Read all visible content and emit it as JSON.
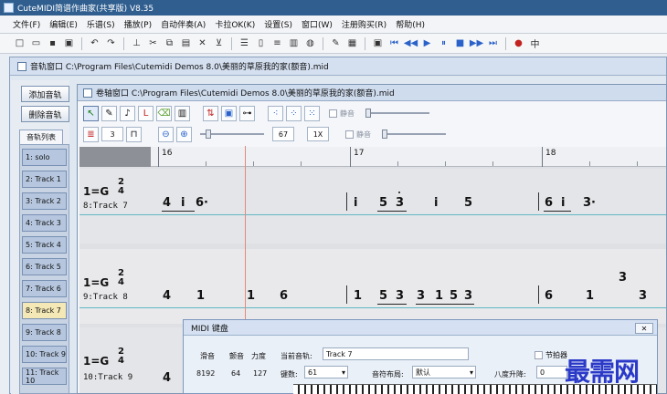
{
  "app": {
    "title": "CuteMIDI简谱作曲家(共享版) V8.35"
  },
  "menu": [
    "文件(F)",
    "编辑(E)",
    "乐谱(S)",
    "播放(P)",
    "自动伴奏(A)",
    "卡拉OK(K)",
    "设置(S)",
    "窗口(W)",
    "注册购买(R)",
    "帮助(H)"
  ],
  "track_window": {
    "title": "音轨窗口  C:\\Program Files\\Cutemidi Demos 8.0\\美丽的草原我的家(额音).mid",
    "add_button": "添加音轨",
    "delete_button": "删除音轨",
    "list_tab": "音轨列表",
    "tracks": [
      "1: solo",
      "2: Track 1",
      "3: Track 2",
      "4: Track 3",
      "5: Track 4",
      "6: Track 5",
      "7: Track 6",
      "8: Track 7",
      "9: Track 8",
      "10: Track 9",
      "11: Track 10"
    ],
    "selected_track": "8: Track 7"
  },
  "piano_roll": {
    "title": "卷轴窗口  C:\\Program Files\\Cutemidi Demos 8.0\\美丽的草原我的家(额音).mid",
    "note_length": "3",
    "volume_value": "67",
    "zoom_value": "1X",
    "mute1": "静音",
    "mute2": "静音",
    "measures": [
      "16",
      "17",
      "18"
    ],
    "key1": "1=G",
    "key2": "1=G",
    "key3": "1=G",
    "time_num": "2",
    "time_den": "4",
    "staff_label_1": "8:Track 7",
    "staff_label_2": "9:Track 8",
    "staff_label_3": "10:Track 9",
    "staff1_notes": [
      "4",
      "i",
      "6·",
      "i",
      "5",
      "3",
      "i",
      "5",
      "6",
      "i",
      "3·"
    ],
    "staff2_notes": [
      "4",
      "1",
      "1",
      "6",
      "1",
      "5",
      "3",
      "3",
      "1",
      "5",
      "3",
      "6",
      "1",
      "3",
      "3"
    ],
    "staff3_notes": [
      "4"
    ]
  },
  "midi_keyboard": {
    "title": "MIDI 键盘",
    "col1": "滑音",
    "col2": "颤音",
    "col3": "力度",
    "val1": "8192",
    "val2": "64",
    "val3": "127",
    "current_track_label": "当前音轨:",
    "current_track_value": "Track 7",
    "metronome_label": "节拍器",
    "keys_label": "键数:",
    "keys_value": "61",
    "layout_label": "音符布局:",
    "layout_value": "默认",
    "octave_label": "八度升降:",
    "octave_value": "0"
  },
  "watermark": "最需网"
}
